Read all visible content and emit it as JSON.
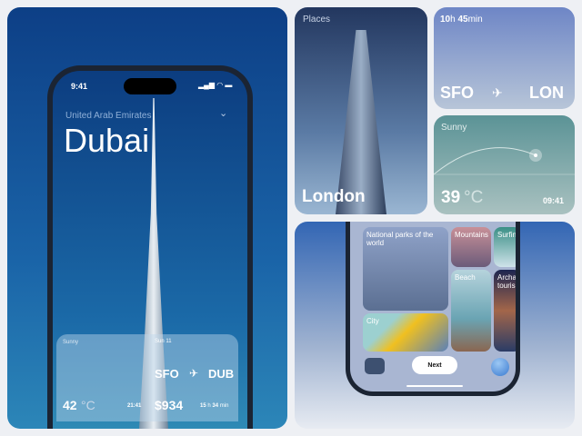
{
  "dubai": {
    "time": "9:41",
    "country": "United Arab Emirates",
    "city": "Dubai",
    "weather": {
      "label": "Sunny",
      "temp": "42",
      "unit": "°C",
      "time": "21:41"
    },
    "flight": {
      "date": "Sun 11",
      "from": "SFO",
      "to": "DUB",
      "price": "$934",
      "hours": "15",
      "h": "h",
      "minutes": "34",
      "min": "min"
    }
  },
  "places": {
    "label": "Places",
    "city": "London"
  },
  "flight_card": {
    "hours": "10",
    "h": "h",
    "minutes": "45",
    "min": "min",
    "from": "SFO",
    "to": "LON"
  },
  "sunny_card": {
    "label": "Sunny",
    "temp": "39",
    "unit": "°C",
    "time": "09:41"
  },
  "parks": {
    "tiles": [
      "National parks of the world",
      "Mountains",
      "Surfing",
      "Beach",
      "Archaeo tourism",
      "City"
    ],
    "next": "Next"
  }
}
